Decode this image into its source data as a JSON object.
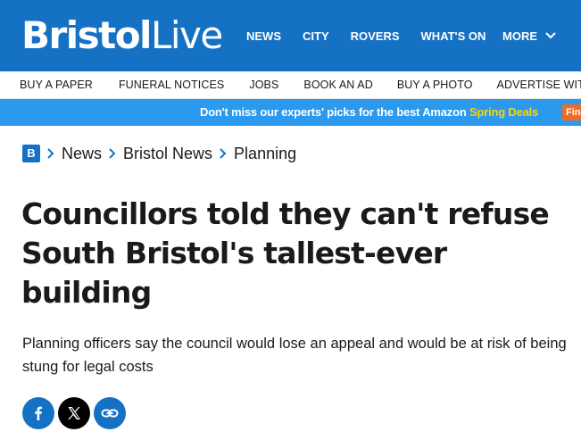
{
  "brand": {
    "logo_bold": "Bristol",
    "logo_light": "Live"
  },
  "main_nav": {
    "items": [
      "NEWS",
      "CITY",
      "ROVERS",
      "WHAT'S ON"
    ],
    "more_label": "MORE"
  },
  "sub_nav": {
    "items": [
      "BUY A PAPER",
      "FUNERAL NOTICES",
      "JOBS",
      "BOOK AN AD",
      "BUY A PHOTO",
      "ADVERTISE WIT"
    ]
  },
  "promo": {
    "text": "Don't miss our experts' picks for the best Amazon ",
    "highlight": "Spring Deals",
    "button": "Fin"
  },
  "breadcrumb": {
    "home": "B",
    "items": [
      "News",
      "Bristol News",
      "Planning"
    ]
  },
  "article": {
    "headline": "Councillors told they can't refuse South Bristol's tallest-ever building",
    "standfirst": "Planning officers say the council would lose an appeal and would be at risk of being stung for legal costs"
  },
  "colors": {
    "brand_blue": "#1571c4",
    "promo_blue": "#2b9aee",
    "promo_highlight": "#ffd400",
    "promo_button": "#f26a21"
  },
  "share": {
    "icons": [
      "facebook-icon",
      "x-icon",
      "link-icon"
    ]
  }
}
